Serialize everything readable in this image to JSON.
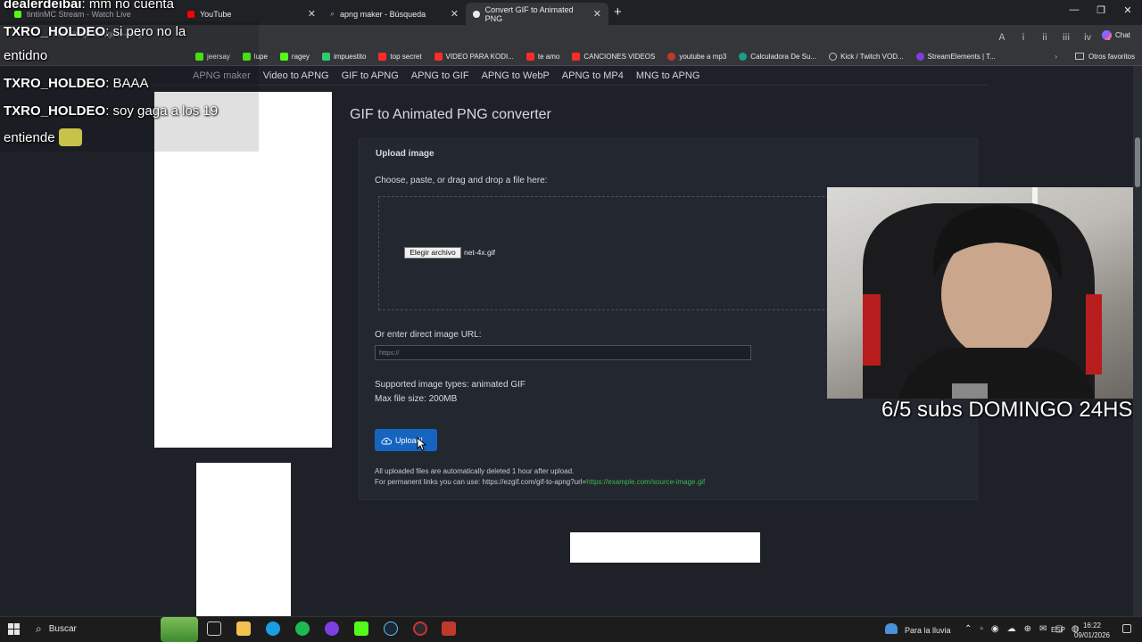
{
  "browser": {
    "tabs": [
      {
        "label": "tintinMC Stream - Watch Live",
        "active": false
      },
      {
        "label": "YouTube",
        "active": false
      },
      {
        "label": "apng maker - Búsqueda",
        "active": false
      },
      {
        "label": "Convert GIF to Animated PNG",
        "active": true
      }
    ],
    "new_tab": "+",
    "address": "https://ezgif.com/gif-to-apng",
    "chat_button": "Chat",
    "bookmarks": [
      "jeersay",
      "lupe",
      "ragey",
      "impuestito",
      "top secret",
      "VIDEO PARA KODI...",
      "te amo",
      "CANCIONES VIDEOS",
      "youtube a mp3",
      "Calculadora De Su...",
      "Kick / Twitch VOD...",
      "StreamElements | T..."
    ],
    "other_bookmarks": "Otros favoritos"
  },
  "site": {
    "nav": [
      "APNG maker",
      "Video to APNG",
      "GIF to APNG",
      "APNG to GIF",
      "APNG to WebP",
      "APNG to MP4",
      "MNG to APNG"
    ],
    "title": "GIF to Animated PNG converter",
    "upload_heading": "Upload image",
    "choose_label": "Choose, paste, or drag and drop a file here:",
    "choose_button": "Elegir archivo",
    "file_name": "net-4x.gif",
    "url_label": "Or enter direct image URL:",
    "url_placeholder": "https://",
    "supported": "Supported image types: animated GIF",
    "max_size": "Max file size: 200MB",
    "upload_button": "Upload!",
    "note1": "All uploaded files are automatically deleted 1 hour after upload.",
    "note2": "For permanent links you can use: https://ezgif.com/gif-to-apng?url=",
    "note2_link": "https://example.com/source-image.gif"
  },
  "chat": [
    {
      "user": "dealerdeibai",
      "text": "mm no cuenta"
    },
    {
      "user": "TXRO_HOLDEO",
      "text": "si pero no la"
    },
    {
      "user": "",
      "text": "entidno"
    },
    {
      "user": "TXRO_HOLDEO",
      "text": "BAAA"
    },
    {
      "user": "TXRO_HOLDEO",
      "text": "soy gaga a los 19"
    },
    {
      "user": "",
      "text": "entiende"
    }
  ],
  "stream_overlay": "6/5 subs DOMINGO 24HS",
  "taskbar": {
    "search": "Buscar",
    "weather": "Para la lluvia",
    "lang": "ESP",
    "time": "16:22",
    "date": "09/01/2026"
  },
  "colors": {
    "page_bg": "#1e2128",
    "panel_bg": "#232730",
    "upload_btn": "#1565c0",
    "link_green": "#3bb84c"
  }
}
